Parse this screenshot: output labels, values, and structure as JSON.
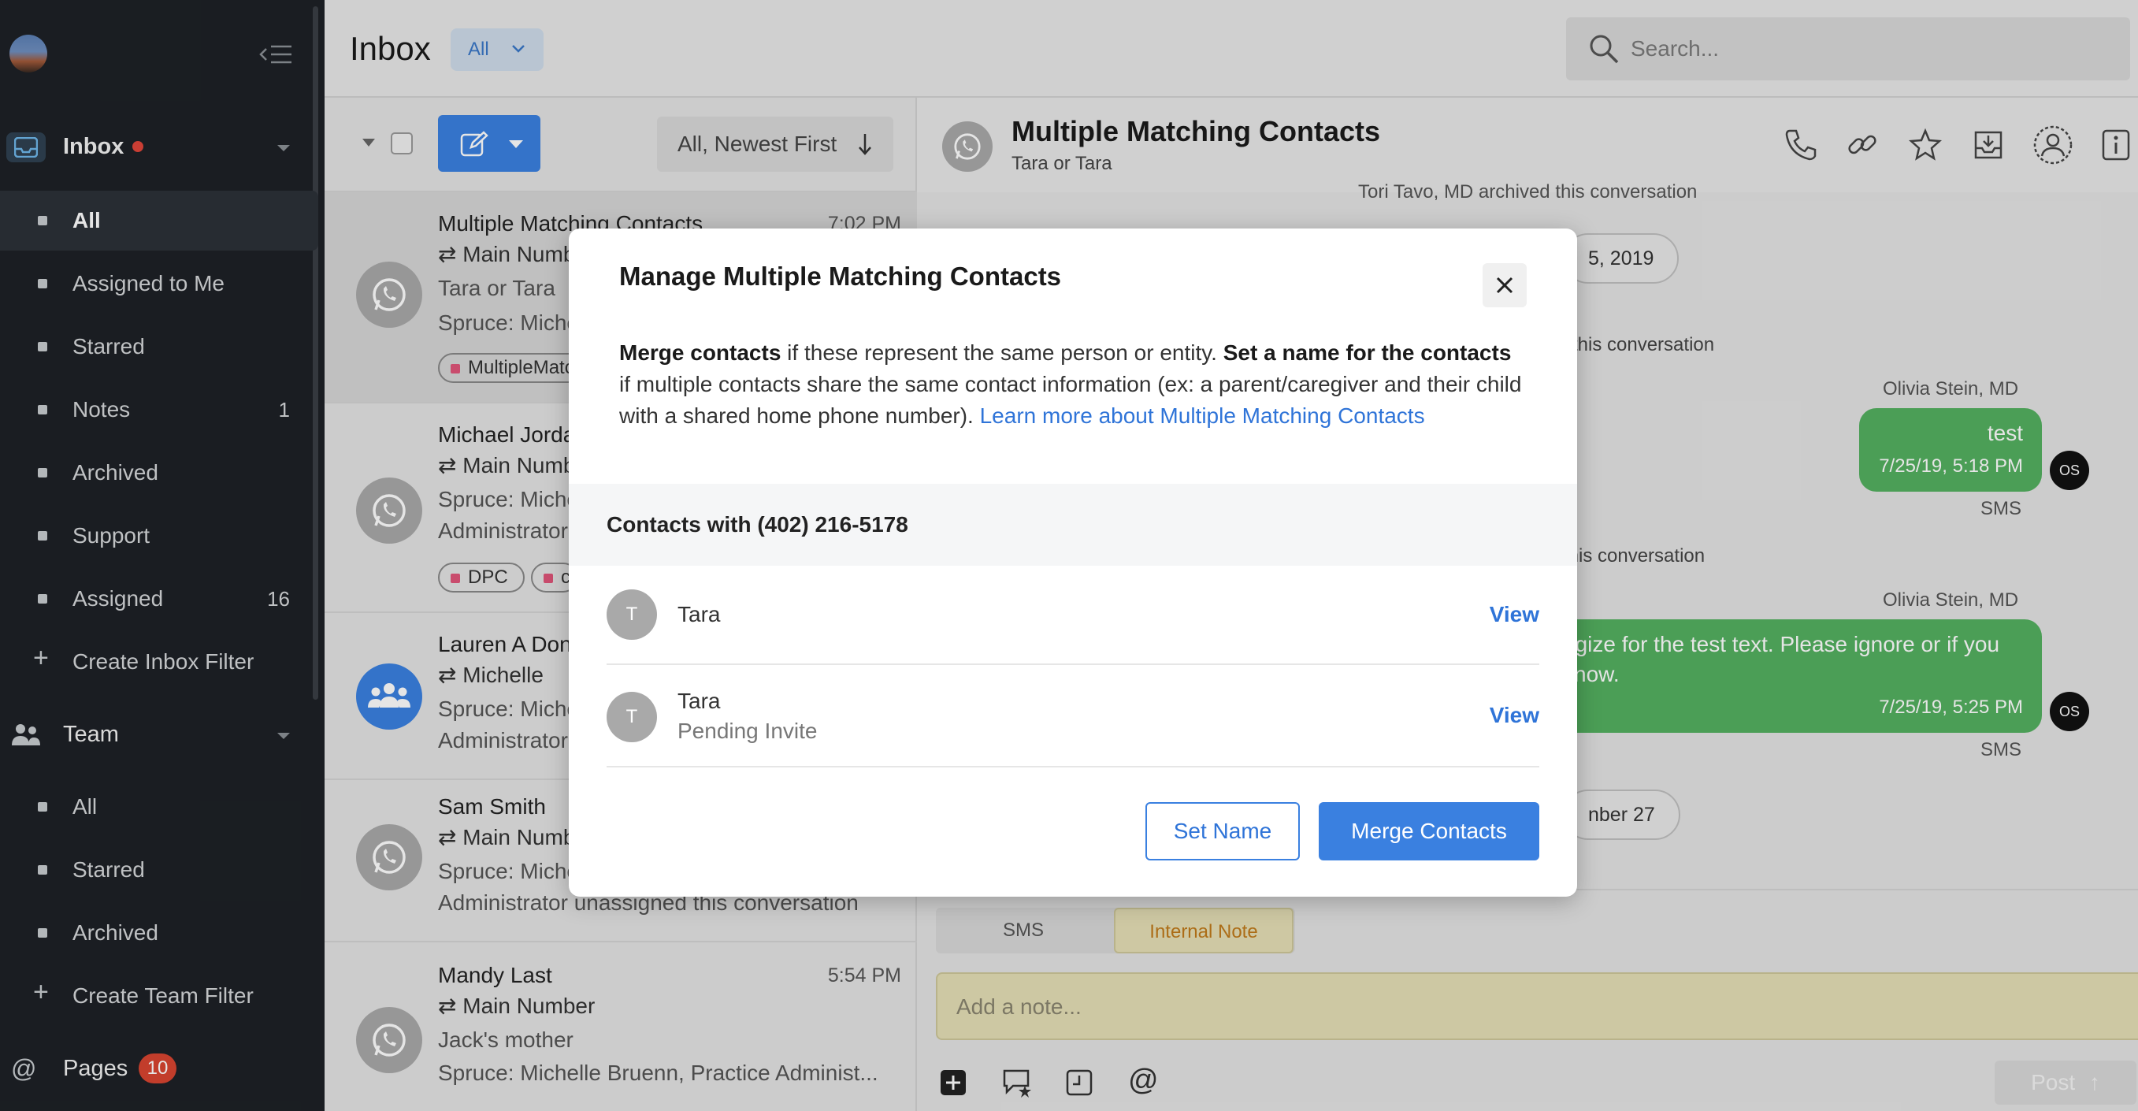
{
  "sidebar": {
    "inbox_label": "Inbox",
    "inbox_items": [
      {
        "label": "All",
        "count": ""
      },
      {
        "label": "Assigned to Me",
        "count": ""
      },
      {
        "label": "Starred",
        "count": ""
      },
      {
        "label": "Notes",
        "count": "1"
      },
      {
        "label": "Archived",
        "count": ""
      },
      {
        "label": "Support",
        "count": ""
      },
      {
        "label": "Assigned",
        "count": "16"
      }
    ],
    "create_inbox_filter": "Create Inbox Filter",
    "team_label": "Team",
    "team_items": [
      {
        "label": "All"
      },
      {
        "label": "Starred"
      },
      {
        "label": "Archived"
      }
    ],
    "create_team_filter": "Create Team Filter",
    "pages_label": "Pages",
    "pages_count": "10"
  },
  "topbar": {
    "title": "Inbox",
    "filter": "All",
    "search_placeholder": "Search..."
  },
  "list": {
    "sort_label": "All, Newest First",
    "conversations": [
      {
        "line1": "Multiple Matching Contacts",
        "time": "7:02 PM",
        "line2": "⇄ Main Number",
        "line3": "Tara or Tara",
        "line4": "Spruce: Michelle",
        "tags": [
          "MultipleMatchingContacts"
        ]
      },
      {
        "line1": "Michael Jordan",
        "time": "",
        "line2": "⇄ Main Number",
        "line3": "Spruce: Michelle",
        "line4": "Administrator",
        "tags": [
          "DPC",
          "c"
        ]
      },
      {
        "line1": "Lauren A Donovan",
        "time": "",
        "line2": "⇄ Michelle",
        "line3": "Spruce: Michelle",
        "line4": "Administrator",
        "tags": []
      },
      {
        "line1": "Sam Smith",
        "time": "",
        "line2": "⇄ Main Number",
        "line3": "Spruce: Michelle",
        "line4": "Administrator unassigned this conversation",
        "tags": []
      },
      {
        "line1": "Mandy Last",
        "time": "5:54 PM",
        "line2": "⇄ Main Number",
        "line3": "Jack's mother",
        "line4": "Spruce: Michelle Bruenn, Practice Administ...",
        "tags": []
      }
    ]
  },
  "conversation": {
    "title": "Multiple Matching Contacts",
    "subtitle": "Tara or Tara",
    "system_top": "Tori Tavo, MD archived this conversation",
    "date1": "5, 2019",
    "system2": "l this conversation",
    "msg1_author": "Olivia Stein, MD",
    "msg1_text": "test",
    "msg1_time": "7/25/19, 5:18 PM",
    "msg1_channel": "SMS",
    "system3": "this conversation",
    "msg2_author": "Olivia Stein, MD",
    "msg2_text_1": "ogize for the test text. Please ignore or if you",
    "msg2_text_2": "know.",
    "msg2_time": "7/25/19, 5:25 PM",
    "msg2_channel": "SMS",
    "date2": "nber 27",
    "avatar_initials": "OS",
    "tab_sms": "SMS",
    "tab_note": "Internal Note",
    "note_placeholder": "Add a note...",
    "post_label": "Post"
  },
  "modal": {
    "title": "Manage Multiple Matching Contacts",
    "desc_merge_bold": "Merge contacts",
    "desc_merge_text": " if these represent the same person or entity. ",
    "desc_name_bold": "Set a name for the contacts",
    "desc_name_text": " if multiple contacts share the same contact information (ex: a parent/caregiver and their child with a shared home phone number). ",
    "desc_link": "Learn more about Multiple Matching Contacts",
    "group_header": "Contacts with (402) 216-5178",
    "contacts": [
      {
        "initial": "T",
        "name": "Tara",
        "sub": "",
        "action": "View"
      },
      {
        "initial": "T",
        "name": "Tara",
        "sub": "Pending Invite",
        "action": "View"
      }
    ],
    "set_name_label": "Set Name",
    "merge_label": "Merge Contacts"
  },
  "colors": {
    "accent": "#3a80e0",
    "sidebar_bg": "#1d2126",
    "message_green": "#54b060",
    "badge_red": "#d94430"
  }
}
